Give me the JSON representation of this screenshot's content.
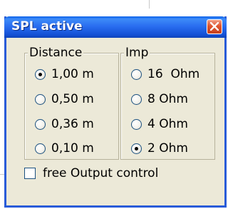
{
  "window": {
    "title": "SPL active"
  },
  "groups": {
    "distance": {
      "label": "Distance",
      "options": [
        {
          "label": "1,00 m",
          "checked": true
        },
        {
          "label": "0,50 m",
          "checked": false
        },
        {
          "label": "0,36 m",
          "checked": false
        },
        {
          "label": "0,10 m",
          "checked": false
        }
      ]
    },
    "imp": {
      "label": "Imp",
      "options": [
        {
          "label": "16  Ohm",
          "checked": false
        },
        {
          "label": "8 Ohm",
          "checked": false
        },
        {
          "label": "4 Ohm",
          "checked": false
        },
        {
          "label": "2 Ohm",
          "checked": true
        }
      ]
    }
  },
  "free_output": {
    "label": "free Output control",
    "checked": false
  },
  "colors": {
    "titlebar": "#2a6ef0",
    "close_button": "#e0552e",
    "dialog_background": "#ece9d8"
  },
  "icons": {
    "close": "close-icon"
  }
}
